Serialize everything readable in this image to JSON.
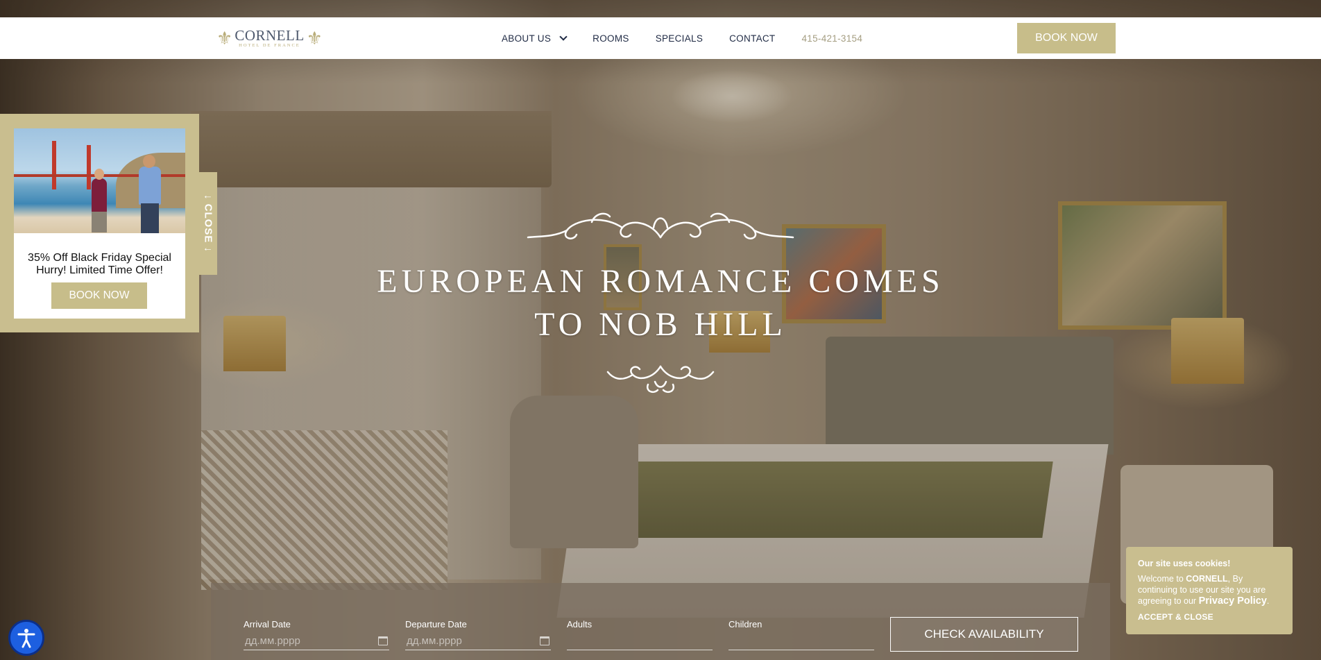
{
  "header": {
    "logo": {
      "name": "CORNELL",
      "sub": "HOTEL DE FRANCE"
    },
    "nav": [
      {
        "label": "ABOUT US",
        "has_dropdown": true
      },
      {
        "label": "ROOMS"
      },
      {
        "label": "SPECIALS"
      },
      {
        "label": "CONTACT"
      }
    ],
    "phone": "415-421-3154",
    "book_now": "BOOK NOW"
  },
  "hero": {
    "title_line1": "EUROPEAN ROMANCE COMES",
    "title_line2": "TO NOB HILL"
  },
  "promo": {
    "title": "35% Off Black Friday Special",
    "subtitle": "Hurry! Limited Time Offer!",
    "book_now": "BOOK NOW",
    "close_label": "↓ CLOSE ↓"
  },
  "booking": {
    "arrival_label": "Arrival Date",
    "arrival_placeholder": "дд.мм.рррр",
    "departure_label": "Departure Date",
    "departure_placeholder": "дд.мм.рррр",
    "adults_label": "Adults",
    "children_label": "Children",
    "check_button": "CHECK AVAILABILITY"
  },
  "cookie": {
    "title": "Our site uses cookies!",
    "body_prefix": "Welcome to ",
    "brand": "CORNELL",
    "body_suffix": ", By continuing to use our site you are agreeing to our ",
    "policy_link": "Privacy Policy",
    "period": ".",
    "accept": "ACCEPT & CLOSE"
  },
  "colors": {
    "accent_gold": "#c7bd8a",
    "nav_text": "#1f2a44",
    "phone_text": "#a59e82"
  },
  "icons": [
    "fleur-de-lis-icon",
    "chevron-down-icon",
    "calendar-icon",
    "accessibility-icon",
    "ornament-scroll-icon"
  ]
}
